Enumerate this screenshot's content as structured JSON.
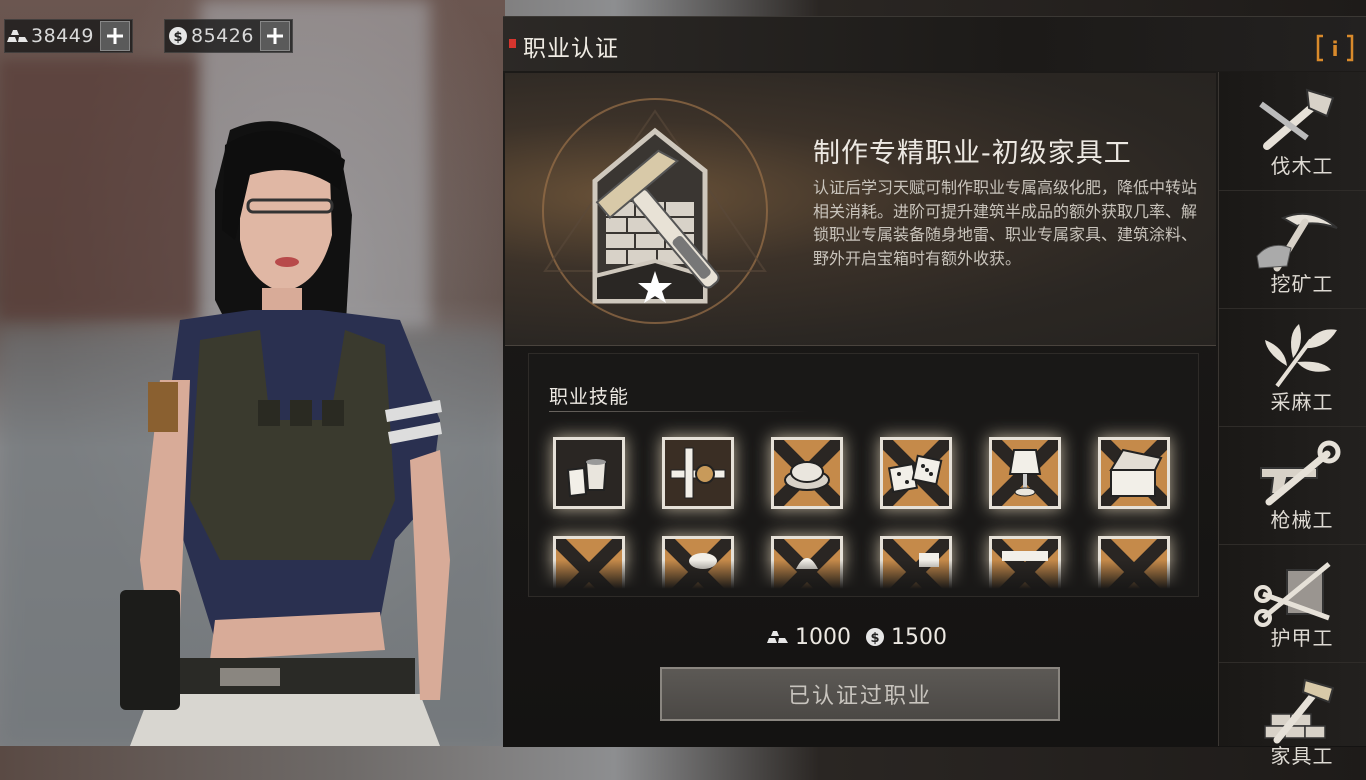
{
  "currencies": {
    "gold": {
      "icon": "gold-bar-icon",
      "value": "38449"
    },
    "silver": {
      "icon": "silver-coin-icon",
      "value": "85426"
    }
  },
  "panel": {
    "title": "职业认证",
    "info_label": "i"
  },
  "job": {
    "name": "制作专精职业-初级家具工",
    "description": "认证后学习天赋可制作职业专属高级化肥，降低中转站相关消耗。进阶可提升建筑半成品的额外获取几率、解锁职业专属装备随身地雷、职业专属家具、建筑涂料、野外开启宝箱时有额外收获。",
    "emblem_icon": "hammer-brick-house-icon"
  },
  "skills": {
    "label": "职业技能",
    "row1": [
      "paint-bucket-icon",
      "gear-pipe-icon",
      "landmine-icon",
      "dice-icon",
      "lamp-icon",
      "treasure-chest-icon"
    ],
    "row2": [
      "skill-icon-7",
      "skill-icon-8",
      "skill-icon-9",
      "skill-icon-10",
      "skill-icon-11",
      "skill-icon-12"
    ]
  },
  "cost": {
    "gold": "1000",
    "silver": "1500"
  },
  "certify_button": "已认证过职业",
  "tabs": [
    {
      "label": "伐木工",
      "icon": "axe-saw-icon"
    },
    {
      "label": "挖矿工",
      "icon": "pickaxe-icon"
    },
    {
      "label": "采麻工",
      "icon": "hemp-leaf-icon"
    },
    {
      "label": "枪械工",
      "icon": "wrench-gun-icon"
    },
    {
      "label": "护甲工",
      "icon": "scissors-armor-icon"
    },
    {
      "label": "家具工",
      "icon": "hammer-brick-icon"
    }
  ],
  "colors": {
    "accent_red": "#d6352e",
    "glow": "#e6e1d8",
    "hero_orange": "#6a5238"
  }
}
